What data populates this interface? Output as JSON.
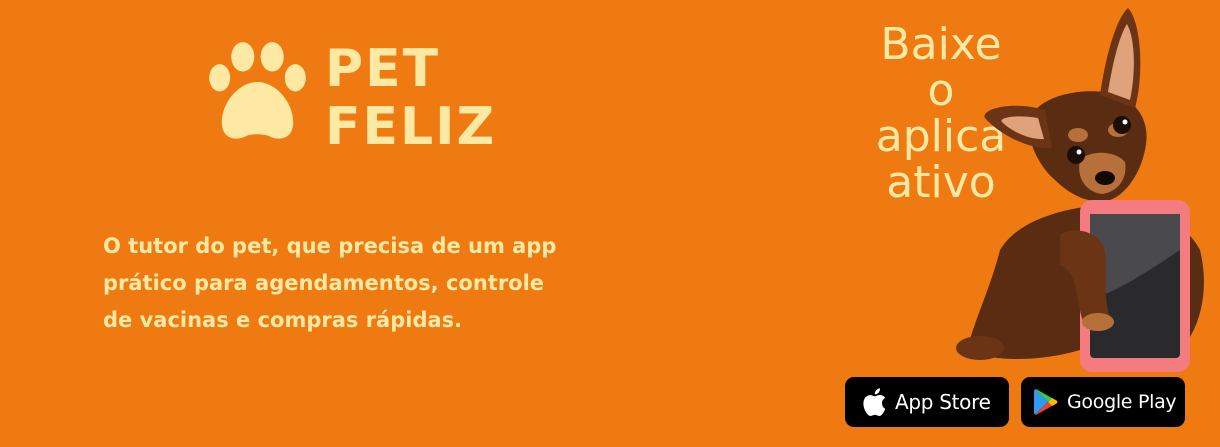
{
  "brand": {
    "line1": "PET",
    "line2": "FELIZ",
    "icon": "paw-icon",
    "color": "#fde9a3"
  },
  "tagline": {
    "lines": [
      "O tutor do pet, que precisa de um app",
      "prático para agendamentos, controle",
      "de vacinas e compras rápidas."
    ]
  },
  "download": {
    "lines": [
      "Baixe",
      "o",
      "aplica",
      "ativo"
    ]
  },
  "stores": {
    "app_store": {
      "label": "App Store",
      "icon": "apple-icon"
    },
    "google_play": {
      "label": "Google Play",
      "icon": "google-play-icon"
    }
  },
  "colors": {
    "background": "#ef7a12",
    "accent_text": "#fde9a3",
    "button_bg": "#000000"
  }
}
